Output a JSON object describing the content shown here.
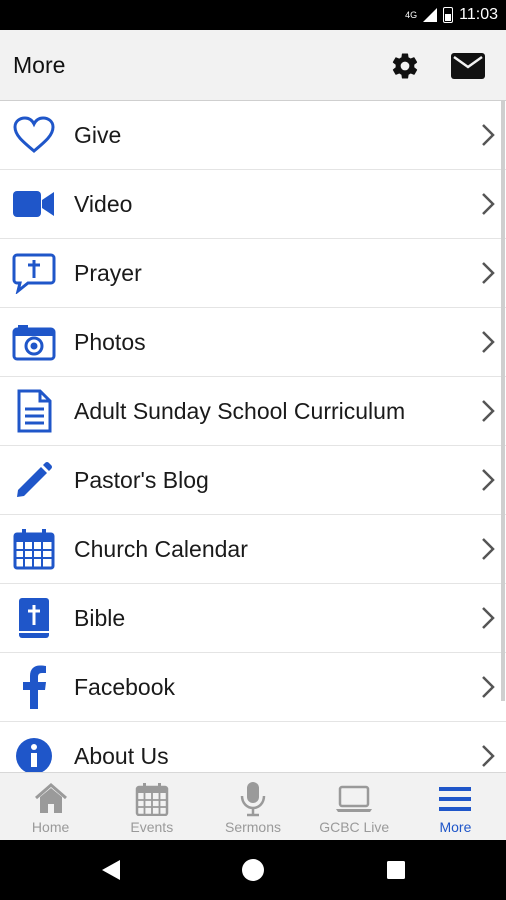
{
  "status": {
    "time": "11:03",
    "network": "4G"
  },
  "appbar": {
    "title": "More",
    "settings_icon": "gear-icon",
    "mail_icon": "envelope-icon"
  },
  "colors": {
    "accent": "#1f56c9",
    "inactive": "#9a9a9a"
  },
  "menu": [
    {
      "label": "Give",
      "icon": "heart-icon"
    },
    {
      "label": "Video",
      "icon": "video-camera-icon"
    },
    {
      "label": "Prayer",
      "icon": "prayer-bubble-icon"
    },
    {
      "label": "Photos",
      "icon": "camera-icon"
    },
    {
      "label": "Adult Sunday School Curriculum",
      "icon": "document-icon"
    },
    {
      "label": "Pastor's Blog",
      "icon": "pencil-icon"
    },
    {
      "label": "Church Calendar",
      "icon": "calendar-icon"
    },
    {
      "label": "Bible",
      "icon": "bible-icon"
    },
    {
      "label": "Facebook",
      "icon": "facebook-icon"
    },
    {
      "label": "About Us",
      "icon": "info-icon"
    }
  ],
  "tabs": [
    {
      "label": "Home",
      "icon": "home-icon",
      "active": false
    },
    {
      "label": "Events",
      "icon": "calendar-icon",
      "active": false
    },
    {
      "label": "Sermons",
      "icon": "microphone-icon",
      "active": false
    },
    {
      "label": "GCBC Live",
      "icon": "laptop-icon",
      "active": false
    },
    {
      "label": "More",
      "icon": "hamburger-menu-icon",
      "active": true
    }
  ]
}
